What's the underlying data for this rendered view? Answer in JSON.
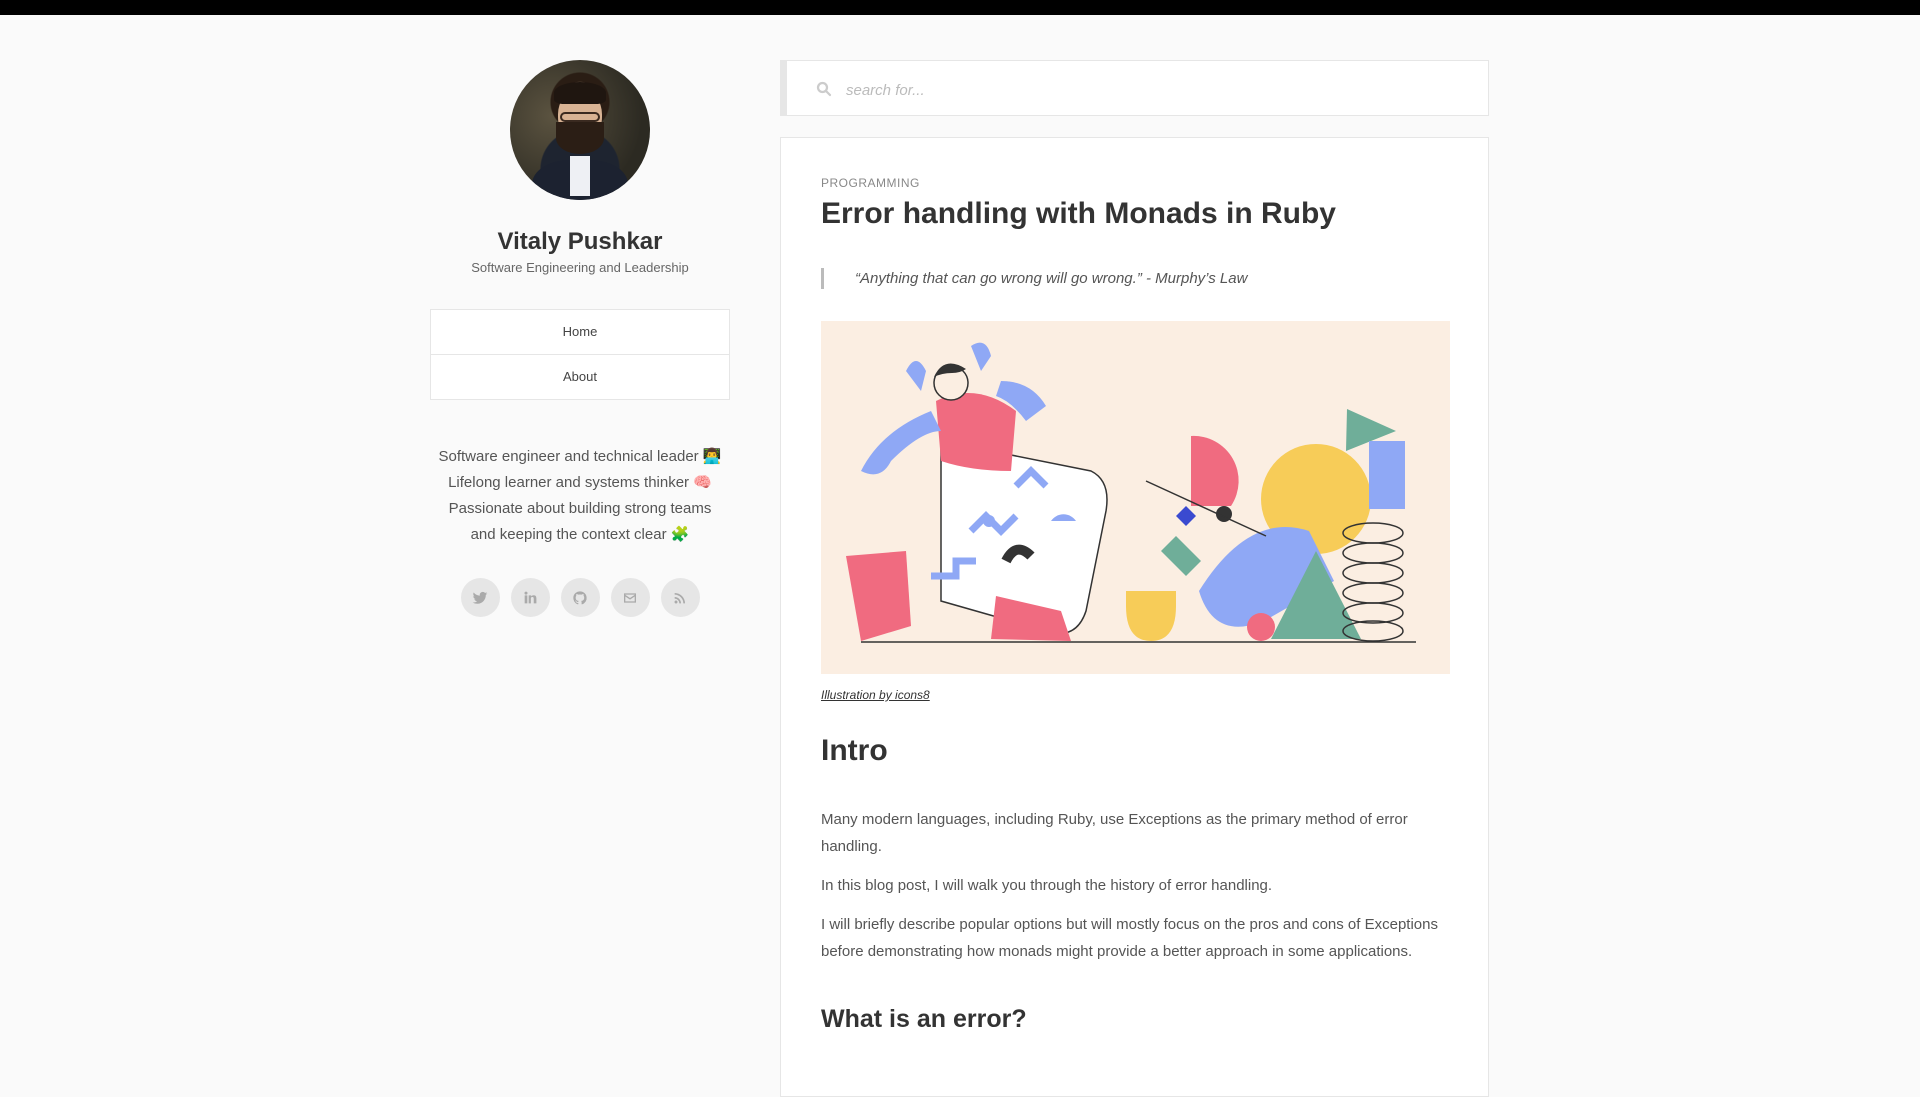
{
  "profile": {
    "name": "Vitaly Pushkar",
    "tagline": "Software Engineering and Leadership",
    "bio_lines": [
      "Software engineer and technical leader 👨‍💻",
      "Lifelong learner and systems thinker 🧠",
      "Passionate about building strong teams",
      "and keeping the context clear 🧩"
    ]
  },
  "nav": {
    "home": "Home",
    "about": "About"
  },
  "socials": [
    "twitter-icon",
    "linkedin-icon",
    "github-icon",
    "mail-icon",
    "rss-icon"
  ],
  "search": {
    "placeholder": "search for..."
  },
  "article": {
    "category": "Programming",
    "title": "Error handling with Monads in Ruby",
    "quote": "“Anything that can go wrong will go wrong.” - Murphy’s Law",
    "caption": "Illustration by icons8",
    "intro_heading": "Intro",
    "paragraphs": [
      "Many modern languages, including Ruby, use Exceptions as the primary method of error handling.",
      "In this blog post, I will walk you through the history of error handling.",
      "I will briefly describe popular options but will mostly focus on the pros and cons of Exceptions before demonstrating how monads might provide a better approach in some applications."
    ],
    "next_heading": "What is an error?"
  },
  "colors": {
    "topbar": "#000000",
    "background": "#fafafa",
    "hero_bg": "#fbeee2"
  }
}
